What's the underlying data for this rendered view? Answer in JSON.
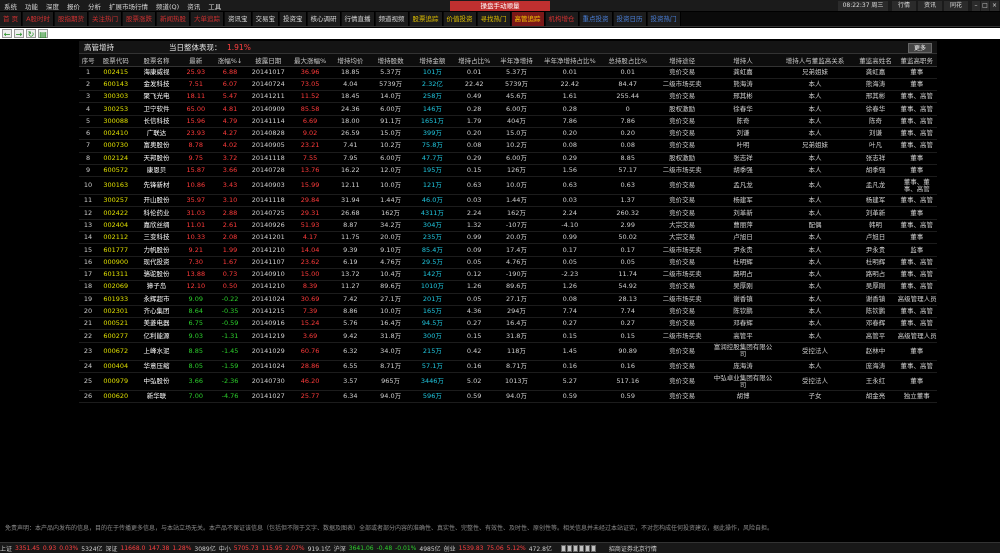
{
  "menu": [
    "系统",
    "功能",
    "深度",
    "报价",
    "分析",
    "扩展市场行情",
    "频道(Q)",
    "资讯",
    "工具"
  ],
  "app_title": "操盘手动顺量",
  "clock": "08:22:37 周三",
  "window_buttons": [
    "行情",
    "资讯",
    "同花"
  ],
  "tabs": [
    {
      "label": "首 页",
      "style": "red"
    },
    {
      "label": "A股时时",
      "style": "red"
    },
    {
      "label": "股指期货",
      "style": "red"
    },
    {
      "label": "关注热门",
      "style": "red"
    },
    {
      "label": "股票涨跌",
      "style": "red"
    },
    {
      "label": "新闻热股",
      "style": "red"
    },
    {
      "label": "大单追踪",
      "style": "red"
    },
    {
      "label": "资讯宝",
      "style": "white"
    },
    {
      "label": "交易宝",
      "style": "white"
    },
    {
      "label": "投资宝",
      "style": "white"
    },
    {
      "label": "核心调研",
      "style": "white"
    },
    {
      "label": "行情直播",
      "style": "white"
    },
    {
      "label": "频道视频",
      "style": "white"
    },
    {
      "label": "股票追踪",
      "style": "yellow"
    },
    {
      "label": "价值投资",
      "style": "yellow"
    },
    {
      "label": "寻找热门",
      "style": "yellow"
    },
    {
      "label": "高管追踪",
      "style": "active"
    },
    {
      "label": "机构增仓",
      "style": "red"
    },
    {
      "label": "重点投资",
      "style": "blue"
    },
    {
      "label": "投资日历",
      "style": "blue"
    },
    {
      "label": "投资热门",
      "style": "blue"
    }
  ],
  "panel": {
    "title": "高管增持",
    "summary_label": "当日整体表现：",
    "summary_value": "1.91%",
    "more_label": "更多"
  },
  "columns": [
    "序号",
    "股票代码",
    "股票名称",
    "最新",
    "涨幅%↓",
    "披露日期",
    "最大涨幅%",
    "增持均价",
    "增持股数",
    "增持金额",
    "增持占比%",
    "半年净增持",
    "半年净增持占比%",
    "总持股占比%",
    "增持途径",
    "增持人",
    "增持人与董监高关系",
    "董监高姓名",
    "董监高职务"
  ],
  "rows": [
    [
      "1",
      "002415",
      "海康威视",
      "25.93",
      "6.88",
      "20141017",
      "36.96",
      "18.85",
      "5.37万",
      "101万",
      "0.01",
      "5.37万",
      "0.01",
      "0.01",
      "竞价交易",
      "龚虹嘉",
      "兄弟姐妹",
      "龚虹嘉",
      "董事"
    ],
    [
      "2",
      "600143",
      "金发科技",
      "7.51",
      "6.07",
      "20140724",
      "73.05",
      "4.04",
      "5739万",
      "2.32亿",
      "22.42",
      "5739万",
      "22.42",
      "84.47",
      "二级市场买卖",
      "熊海涛",
      "本人",
      "熊海涛",
      "董事"
    ],
    [
      "3",
      "300303",
      "聚飞光电",
      "18.11",
      "5.47",
      "20141211",
      "11.52",
      "18.45",
      "14.0万",
      "258万",
      "0.49",
      "45.6万",
      "1.61",
      "255.44",
      "竞价交易",
      "邢其彬",
      "本人",
      "邢其彬",
      "董事、高管"
    ],
    [
      "4",
      "300253",
      "卫宁软件",
      "65.00",
      "4.81",
      "20140909",
      "85.58",
      "24.36",
      "6.00万",
      "146万",
      "0.28",
      "6.00万",
      "0.28",
      "0",
      "股权激励",
      "徐春华",
      "本人",
      "徐春华",
      "董事、高管"
    ],
    [
      "5",
      "300088",
      "长信科技",
      "15.96",
      "4.79",
      "20141114",
      "6.69",
      "18.00",
      "91.1万",
      "1651万",
      "1.79",
      "404万",
      "7.86",
      "7.86",
      "竞价交易",
      "陈奇",
      "本人",
      "陈奇",
      "董事、高管"
    ],
    [
      "6",
      "002410",
      "广联达",
      "23.93",
      "4.27",
      "20140828",
      "9.02",
      "26.59",
      "15.0万",
      "399万",
      "0.20",
      "15.0万",
      "0.20",
      "0.20",
      "竞价交易",
      "刘谦",
      "本人",
      "刘谦",
      "董事、高管"
    ],
    [
      "7",
      "000730",
      "富奥股份",
      "8.78",
      "4.02",
      "20140905",
      "23.21",
      "7.41",
      "10.2万",
      "75.8万",
      "0.08",
      "10.2万",
      "0.08",
      "0.08",
      "竞价交易",
      "叶明",
      "兄弟姐妹",
      "叶凡",
      "董事、高管"
    ],
    [
      "8",
      "002124",
      "天邦股份",
      "9.75",
      "3.72",
      "20141118",
      "7.55",
      "7.95",
      "6.00万",
      "47.7万",
      "0.29",
      "6.00万",
      "0.29",
      "8.85",
      "股权激励",
      "张志祥",
      "本人",
      "张志祥",
      "董事"
    ],
    [
      "9",
      "600572",
      "康恩贝",
      "15.87",
      "3.66",
      "20140728",
      "13.76",
      "16.22",
      "12.0万",
      "195万",
      "0.15",
      "126万",
      "1.56",
      "57.17",
      "二级市场买卖",
      "胡季强",
      "本人",
      "胡季强",
      "董事"
    ],
    [
      "10",
      "300163",
      "先锋新材",
      "10.86",
      "3.43",
      "20140903",
      "15.99",
      "12.11",
      "10.0万",
      "121万",
      "0.63",
      "10.0万",
      "0.63",
      "0.63",
      "竞价交易",
      "孟凡龙",
      "本人",
      "孟凡龙",
      "董事、董事、高管"
    ],
    [
      "11",
      "300257",
      "开山股份",
      "35.97",
      "3.10",
      "20141118",
      "29.84",
      "31.94",
      "1.44万",
      "46.0万",
      "0.03",
      "1.44万",
      "0.03",
      "1.37",
      "竞价交易",
      "杨建军",
      "本人",
      "杨建军",
      "董事、高管"
    ],
    [
      "12",
      "002422",
      "科伦药业",
      "31.03",
      "2.88",
      "20140725",
      "29.31",
      "26.68",
      "162万",
      "4311万",
      "2.24",
      "162万",
      "2.24",
      "260.32",
      "竞价交易",
      "刘革新",
      "本人",
      "刘革新",
      "董事"
    ],
    [
      "13",
      "002404",
      "嘉欣丝绸",
      "11.01",
      "2.61",
      "20140926",
      "51.93",
      "8.87",
      "34.2万",
      "304万",
      "1.32",
      "-107万",
      "-4.10",
      "2.99",
      "大宗交易",
      "曹丽萍",
      "配偶",
      "韩明",
      "董事、高管"
    ],
    [
      "14",
      "002112",
      "三变科技",
      "10.33",
      "2.08",
      "20141201",
      "4.17",
      "11.75",
      "20.0万",
      "235万",
      "0.99",
      "20.0万",
      "0.99",
      "50.02",
      "大宗交易",
      "卢旭日",
      "本人",
      "卢旭日",
      "董事"
    ],
    [
      "15",
      "601777",
      "力帆股份",
      "9.21",
      "1.99",
      "20141210",
      "14.04",
      "9.39",
      "9.10万",
      "85.4万",
      "0.09",
      "17.4万",
      "0.17",
      "0.17",
      "二级市场买卖",
      "尹永贵",
      "本人",
      "尹永贵",
      "监事"
    ],
    [
      "16",
      "000900",
      "现代投资",
      "7.30",
      "1.67",
      "20141107",
      "23.62",
      "6.19",
      "4.76万",
      "29.5万",
      "0.05",
      "4.76万",
      "0.05",
      "0.05",
      "竞价交易",
      "杜明辉",
      "本人",
      "杜明辉",
      "董事、高管"
    ],
    [
      "17",
      "601311",
      "骆驼股份",
      "13.88",
      "0.73",
      "20140910",
      "15.00",
      "13.72",
      "10.4万",
      "142万",
      "0.12",
      "-190万",
      "-2.23",
      "11.74",
      "二级市场买卖",
      "路明占",
      "本人",
      "路明占",
      "董事、高管"
    ],
    [
      "18",
      "002069",
      "獐子岛",
      "12.10",
      "0.50",
      "20141210",
      "8.39",
      "11.27",
      "89.6万",
      "1010万",
      "1.26",
      "89.6万",
      "1.26",
      "54.92",
      "竞价交易",
      "吴厚刚",
      "本人",
      "吴厚刚",
      "董事、高管"
    ],
    [
      "19",
      "601933",
      "永辉超市",
      "9.09",
      "-0.22",
      "20141024",
      "30.69",
      "7.42",
      "27.1万",
      "201万",
      "0.05",
      "27.1万",
      "0.08",
      "28.13",
      "二级市场买卖",
      "谢香镇",
      "本人",
      "谢香镇",
      "高级管理人员"
    ],
    [
      "20",
      "002301",
      "齐心集团",
      "8.64",
      "-0.35",
      "20141215",
      "7.39",
      "8.86",
      "10.0万",
      "165万",
      "4.36",
      "294万",
      "7.74",
      "7.74",
      "竞价交易",
      "陈钦鹏",
      "本人",
      "陈钦鹏",
      "董事、高管"
    ],
    [
      "21",
      "000521",
      "美菱电器",
      "6.75",
      "-0.59",
      "20140916",
      "15.24",
      "5.76",
      "16.4万",
      "94.5万",
      "0.27",
      "16.4万",
      "0.27",
      "0.27",
      "竞价交易",
      "邓春辉",
      "本人",
      "邓春辉",
      "董事、高管"
    ],
    [
      "22",
      "600277",
      "亿利能源",
      "9.03",
      "-1.31",
      "20141219",
      "3.69",
      "9.42",
      "31.8万",
      "300万",
      "0.15",
      "31.8万",
      "0.15",
      "0.15",
      "二级市场买卖",
      "高管平",
      "本人",
      "高管平",
      "高级管理人员"
    ],
    [
      "23",
      "000672",
      "上峰水泥",
      "8.85",
      "-1.45",
      "20141029",
      "60.76",
      "6.32",
      "34.0万",
      "215万",
      "0.42",
      "118万",
      "1.45",
      "90.89",
      "竞价交易",
      "富润控股集团有限公司",
      "受控法人",
      "赵林中",
      "董事"
    ],
    [
      "24",
      "000404",
      "华意压缩",
      "8.05",
      "-1.59",
      "20141024",
      "28.86",
      "6.55",
      "8.71万",
      "57.1万",
      "0.16",
      "8.71万",
      "0.16",
      "0.16",
      "竞价交易",
      "庞海涛",
      "本人",
      "庞海涛",
      "董事、高管"
    ],
    [
      "25",
      "000979",
      "中弘股份",
      "3.66",
      "-2.36",
      "20140730",
      "46.20",
      "3.57",
      "965万",
      "3446万",
      "5.02",
      "1013万",
      "5.27",
      "517.16",
      "竞价交易",
      "中弘卓业集团有限公司",
      "受控法人",
      "王永红",
      "董事"
    ],
    [
      "26",
      "000620",
      "新华联",
      "7.00",
      "-4.76",
      "20141027",
      "25.77",
      "6.34",
      "94.0万",
      "596万",
      "0.59",
      "94.0万",
      "0.59",
      "0.59",
      "竞价交易",
      "胡博",
      "子女",
      "胡金亮",
      "独立董事"
    ]
  ],
  "disclaimer": "免责声明：本产品内发布的信息，目的在于传播更多信息，与本站立场无关。本产品不保证该信息（包括但不限于文字、数据及图表）全部或者部分内容的准确性、真实性、完整性、有效性、及时性、原创性等。相关信息并未经过本站证实，不对您构成任何投资建议，据此操作，风险自担。",
  "status": {
    "sh": {
      "label": "上证",
      "index": "3351.45",
      "chg": "0.93",
      "pct": "0.03%",
      "vol": "5324亿"
    },
    "sz": {
      "label": "深证",
      "index": "11668.0",
      "chg": "147.38",
      "pct": "1.28%",
      "vol": "3089亿"
    },
    "zxb": {
      "label": "中小",
      "index": "5705.73",
      "chg": "115.95",
      "pct": "2.07%",
      "vol": "919.1亿"
    },
    "hs300": {
      "label": "沪深",
      "index": "3641.06",
      "chg": "-0.48",
      "pct": "-0.01%",
      "vol": "4985亿"
    },
    "cyb": {
      "label": "创业",
      "index": "1539.83",
      "chg": "75.06",
      "pct": "5.12%",
      "vol": "472.8亿"
    },
    "broker": "招商证券北京行情"
  }
}
